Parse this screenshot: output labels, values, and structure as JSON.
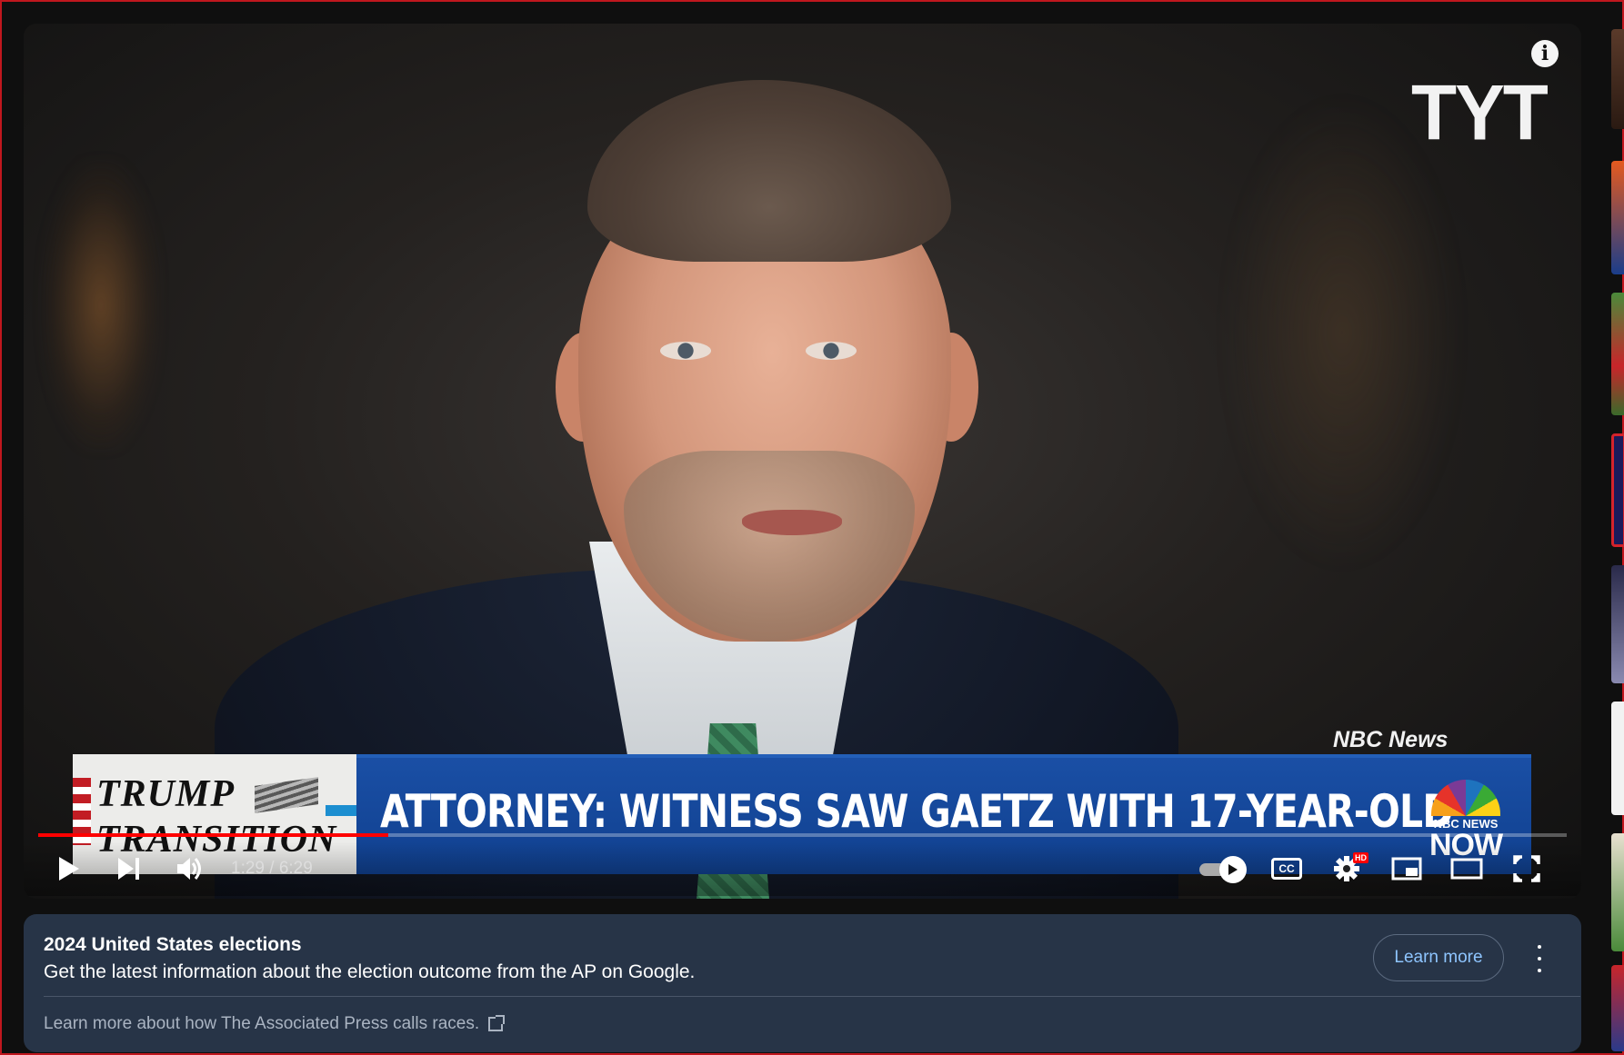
{
  "video": {
    "watermark": "TYT",
    "source_credit": "NBC News",
    "info_icon": "i",
    "lower_third": {
      "segment_line1": "TRUMP",
      "segment_line2": "TRANSITION",
      "headline": "ATTORNEY: WITNESS SAW GAETZ WITH 17-YEAR-OLD",
      "network_small": "NBC NEWS",
      "network_big": "NOW"
    }
  },
  "controls": {
    "time_display": "1:29 / 6:29",
    "progress": 0.229,
    "progress_color": "#ff0000",
    "icons": [
      "play-icon",
      "next-icon",
      "volume-icon",
      "autoplay-toggle",
      "captions-icon",
      "settings-icon",
      "miniplayer-icon",
      "theater-icon",
      "fullscreen-icon"
    ],
    "cc_label": "CC",
    "hd_badge": "HD"
  },
  "panel": {
    "title": "2024 United States elections",
    "description": "Get the latest information about the election outcome from the AP on Google.",
    "learn_more": "Learn more",
    "footer_link": "Learn more about how The Associated Press calls races.",
    "background": "#273447",
    "accent": "#8ec5ff"
  }
}
